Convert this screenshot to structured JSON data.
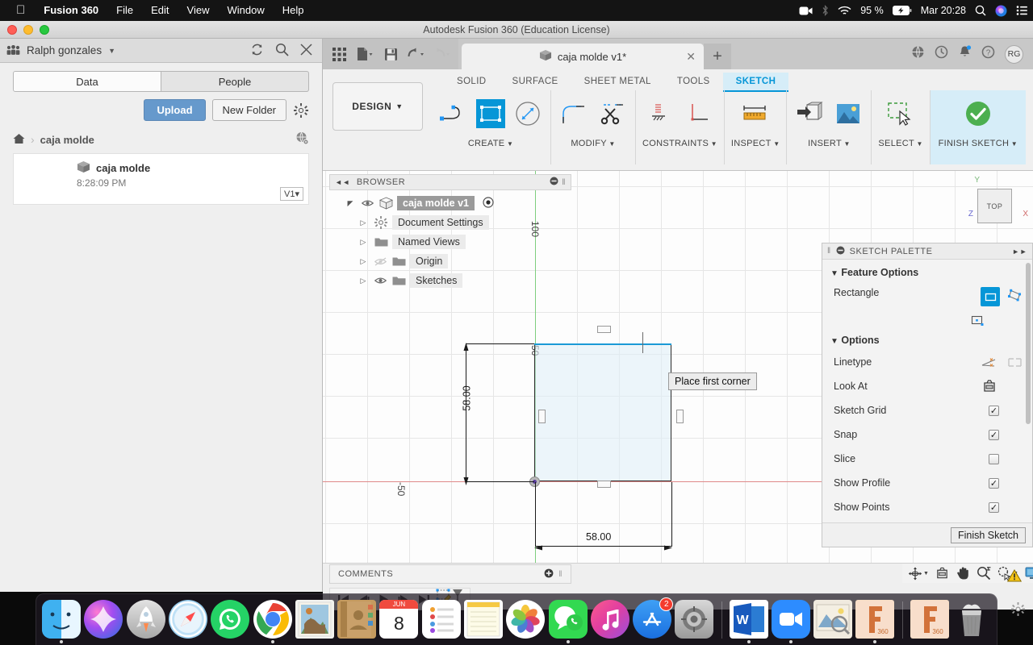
{
  "macbar": {
    "apple_icon": "apple-icon",
    "app_name": "Fusion 360",
    "menus": [
      "File",
      "Edit",
      "View",
      "Window",
      "Help"
    ],
    "status": {
      "screen_icon": "screen-record-icon",
      "bluetooth_icon": "bluetooth-icon",
      "wifi_icon": "wifi-icon",
      "battery_percent": "95 %",
      "battery_icon": "battery-charging-icon",
      "datetime": "Mar 20:28",
      "search_icon": "spotlight-search-icon",
      "siri_icon": "siri-icon",
      "controlcenter_icon": "control-center-icon"
    }
  },
  "window": {
    "title": "Autodesk Fusion 360 (Education License)"
  },
  "datapanel": {
    "user_name": "Ralph gonzales",
    "people_icon": "people-icon",
    "caret_icon": "chevron-down-icon",
    "refresh_icon": "refresh-icon",
    "search_icon": "search-icon",
    "close_icon": "close-icon",
    "tabs": [
      {
        "label": "Data",
        "active": true
      },
      {
        "label": "People",
        "active": false
      }
    ],
    "upload_label": "Upload",
    "new_folder_label": "New Folder",
    "settings_icon": "gear-icon",
    "breadcrumb": {
      "home_icon": "home-icon",
      "sep": "›",
      "current": "caja molde",
      "globe_icon": "globe-icon"
    },
    "file": {
      "thumb_icon": "cube-icon",
      "name": "caja molde",
      "time": "8:28:09 PM",
      "version": "V1",
      "version_caret": "▾"
    }
  },
  "fusion": {
    "quickaccess": {
      "grid_icon": "app-grid-icon",
      "file_icon": "new-file-icon",
      "save_icon": "save-icon",
      "undo_icon": "undo-icon",
      "redo_icon": "redo-icon"
    },
    "doc_tab": {
      "label": "caja molde v1*",
      "icon": "cube-icon",
      "close_icon": "close-icon"
    },
    "new_tab_icon": "plus-icon",
    "tab_right_icons": [
      "globe-data-icon",
      "job-status-icon",
      "notifications-bell-icon",
      "help-icon"
    ],
    "avatar_initials": "RG",
    "workspace_tabs": [
      {
        "label": "SOLID",
        "active": false
      },
      {
        "label": "SURFACE",
        "active": false
      },
      {
        "label": "SHEET METAL",
        "active": false
      },
      {
        "label": "TOOLS",
        "active": false
      },
      {
        "label": "SKETCH",
        "active": true
      }
    ],
    "design_button": "DESIGN",
    "design_caret": "▾",
    "ribbon_groups": [
      {
        "label": "CREATE",
        "caret": "▾",
        "icons": [
          "line-icon",
          "rectangle-icon",
          "sketch-dimension-icon"
        ]
      },
      {
        "label": "MODIFY",
        "caret": "▾",
        "icons": [
          "fillet-icon",
          "trim-scissors-icon"
        ]
      },
      {
        "label": "CONSTRAINTS",
        "caret": "▾",
        "icons": [
          "fix-constraint-icon",
          "perpendicular-constraint-icon"
        ]
      },
      {
        "label": "INSPECT",
        "caret": "▾",
        "icons": [
          "measure-ruler-icon"
        ]
      },
      {
        "label": "INSERT",
        "caret": "▾",
        "icons": [
          "insert-derive-icon",
          "insert-image-icon"
        ]
      },
      {
        "label": "SELECT",
        "caret": "▾",
        "icons": [
          "select-window-icon"
        ]
      },
      {
        "label": "FINISH SKETCH",
        "caret": "▾",
        "icons": [
          "green-check-icon"
        ]
      }
    ],
    "browser": {
      "title": "BROWSER",
      "collapse_icon": "collapse-left-icon",
      "minimize_icon": "minus-circle-icon",
      "grip_icon": "grip-icon",
      "items": [
        {
          "label": "caja molde v1",
          "icon": "cube-icon",
          "eye": true,
          "root": true,
          "dot_icon": "target-dot-icon"
        },
        {
          "label": "Document Settings",
          "icon": "gear-icon",
          "eye": false,
          "root": false
        },
        {
          "label": "Named Views",
          "icon": "folder-icon",
          "eye": false,
          "root": false
        },
        {
          "label": "Origin",
          "icon": "folder-icon",
          "eye": true,
          "hidden_eye": true,
          "root": false
        },
        {
          "label": "Sketches",
          "icon": "folder-icon",
          "eye": true,
          "root": false
        }
      ]
    },
    "canvas": {
      "tooltip": "Place first corner",
      "viewcube_label": "TOP",
      "axis_labels": {
        "y": "Y",
        "z": "Z",
        "x": "X"
      },
      "grid_ticks": [
        "100",
        "50",
        "-50"
      ],
      "dimensions": {
        "vertical": "58.00",
        "horizontal": "58.00"
      },
      "origin_icon": "origin-point-icon"
    },
    "palette": {
      "title": "SKETCH PALETTE",
      "minimize_icon": "minus-circle-icon",
      "expand_icon": "expand-right-icon",
      "sections": [
        {
          "title": "Feature Options",
          "rows": [
            {
              "label": "Rectangle",
              "type": "buttons",
              "icons": [
                "rect-2point-icon",
                "rect-3point-icon",
                "rect-center-icon"
              ],
              "selected": 0
            }
          ]
        },
        {
          "title": "Options",
          "rows": [
            {
              "label": "Linetype",
              "type": "buttons",
              "icons": [
                "construction-line-icon",
                "centerline-icon"
              ]
            },
            {
              "label": "Look At",
              "type": "buttons",
              "icons": [
                "look-at-icon"
              ]
            },
            {
              "label": "Sketch Grid",
              "type": "checkbox",
              "checked": true
            },
            {
              "label": "Snap",
              "type": "checkbox",
              "checked": true
            },
            {
              "label": "Slice",
              "type": "checkbox",
              "checked": false
            },
            {
              "label": "Show Profile",
              "type": "checkbox",
              "checked": true
            },
            {
              "label": "Show Points",
              "type": "checkbox",
              "checked": true
            }
          ]
        }
      ],
      "finish_button": "Finish Sketch"
    },
    "comments": {
      "label": "COMMENTS",
      "add_icon": "add-comment-icon",
      "grip_icon": "grip-icon"
    },
    "navtools": [
      "orbit-icon",
      "look-at-icon",
      "pan-hand-icon",
      "zoom-icon",
      "fit-icon",
      "display-settings-icon",
      "grid-snap-icon",
      "viewports-icon"
    ],
    "warning_icon": "warning-triangle-icon",
    "timeline": {
      "buttons": [
        "skip-to-start-icon",
        "step-back-icon",
        "play-icon",
        "step-forward-icon",
        "skip-to-end-icon"
      ],
      "marker_icon": "sketch-timeline-marker-icon",
      "settings_icon": "gear-icon"
    }
  },
  "dock": {
    "items": [
      {
        "name": "finder",
        "label": "Finder",
        "running": true
      },
      {
        "name": "siri",
        "label": "Siri",
        "running": false
      },
      {
        "name": "launchpad",
        "label": "Launchpad",
        "running": false
      },
      {
        "name": "safari",
        "label": "Safari",
        "running": false
      },
      {
        "name": "whatsapp",
        "label": "WhatsApp",
        "running": false
      },
      {
        "name": "chrome",
        "label": "Google Chrome",
        "running": true
      },
      {
        "name": "mail",
        "label": "Mail",
        "running": false
      },
      {
        "name": "contacts",
        "label": "Contacts",
        "running": false
      },
      {
        "name": "calendar",
        "label": "Calendar",
        "day": "8",
        "month": "JUN",
        "running": false
      },
      {
        "name": "reminders",
        "label": "Reminders",
        "running": false
      },
      {
        "name": "notes",
        "label": "Notes",
        "running": false
      },
      {
        "name": "photos",
        "label": "Photos",
        "running": false
      },
      {
        "name": "messages",
        "label": "Messages",
        "running": true
      },
      {
        "name": "music",
        "label": "Music",
        "running": false
      },
      {
        "name": "appstore",
        "label": "App Store",
        "badge": "2",
        "running": false
      },
      {
        "name": "systempreferences",
        "label": "System Preferences",
        "running": false
      },
      {
        "name": "word",
        "label": "Microsoft Word",
        "running": true,
        "letter": "W"
      },
      {
        "name": "zoom",
        "label": "Zoom",
        "running": true
      },
      {
        "name": "preview",
        "label": "Preview",
        "running": false
      },
      {
        "name": "fusion360-a",
        "label": "Fusion 360",
        "running": true,
        "sublabel": "360"
      },
      {
        "name": "fusion360-b",
        "label": "Fusion 360",
        "running": false,
        "sublabel": "360"
      },
      {
        "name": "trash",
        "label": "Trash",
        "running": false
      }
    ]
  }
}
